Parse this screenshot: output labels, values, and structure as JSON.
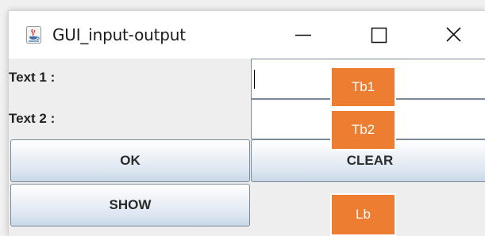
{
  "window": {
    "title": "GUI_input-output",
    "app_icon": "java-cup-icon",
    "controls": [
      "minimize-icon",
      "maximize-icon",
      "close-icon"
    ]
  },
  "form": {
    "text1_label": "Text 1 :",
    "text2_label": "Text 2 :",
    "text1_value": "",
    "text2_value": "",
    "ok_label": "OK",
    "clear_label": "CLEAR",
    "show_label": "SHOW",
    "output_value": ""
  },
  "annotations": {
    "tb1": "Tb1",
    "tb2": "Tb2",
    "lb": "Lb",
    "color": "#ed7d31"
  }
}
